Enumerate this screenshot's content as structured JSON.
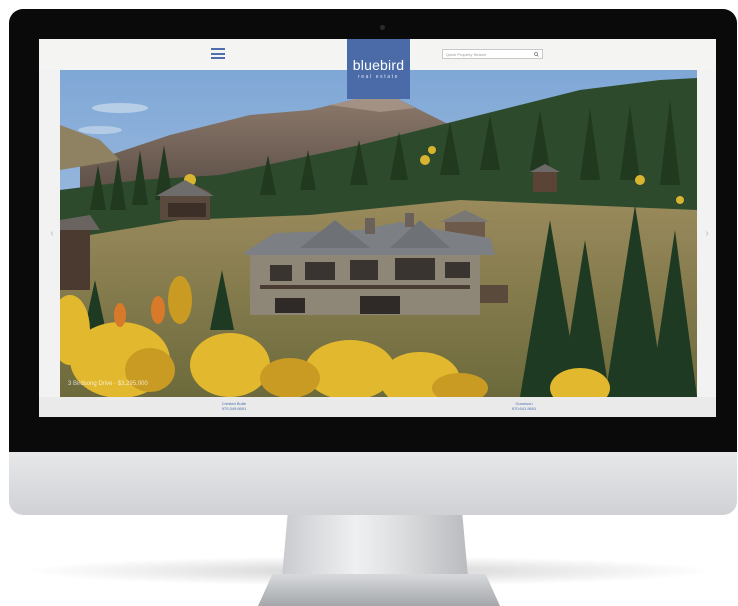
{
  "header": {
    "logo": {
      "name": "bluebird",
      "tagline": "real estate"
    },
    "search": {
      "placeholder": "Quick Property Search",
      "icon": "search-icon"
    },
    "menu_icon": "hamburger-menu-icon"
  },
  "hero": {
    "caption": "3 Birdsong Drive · $3,295,000",
    "nav": {
      "prev_icon": "chevron-left-icon",
      "prev": "‹",
      "next_icon": "chevron-right-icon",
      "next": "›"
    }
  },
  "footer": {
    "offices": [
      {
        "name": "Crested Butte",
        "phone": "970.349.6691"
      },
      {
        "name": "Gunnison",
        "phone": "970.641.9691"
      }
    ]
  },
  "colors": {
    "brand": "#4a6ba8",
    "link": "#4d6fae"
  }
}
